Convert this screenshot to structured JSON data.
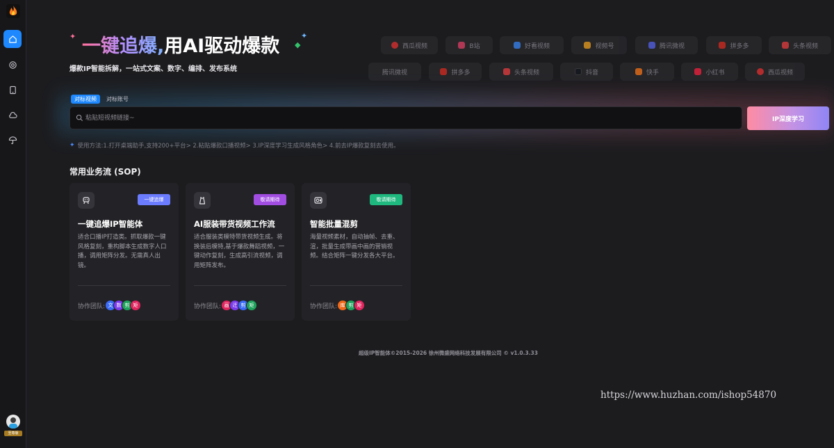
{
  "sidebar": {
    "nav": [
      {
        "name": "home"
      },
      {
        "name": "discover"
      },
      {
        "name": "tablet"
      },
      {
        "name": "cloud"
      },
      {
        "name": "umbrella"
      }
    ],
    "user": {
      "badge": "至尊版"
    }
  },
  "hero": {
    "title_gradient": "一键追爆,",
    "title_white": "用AI驱动爆款",
    "subtitle": "爆款IP智能拆解，一站式文案、数字、编排、发布系统"
  },
  "platforms_row1": [
    "西瓜视频",
    "B站",
    "好看视频",
    "视频号",
    "腾讯微视",
    "拼多多",
    "头条视频"
  ],
  "platforms_row2": [
    "腾讯微视",
    "拼多多",
    "头条视频",
    "抖音",
    "快手",
    "小红书",
    "西瓜视频"
  ],
  "search": {
    "tabs": [
      "对标视频",
      "对标账号"
    ],
    "placeholder": "粘贴短视频链接~",
    "button_label": "IP深度学习",
    "tip": "使用方法:1.打开桌端助手,支持200+平台> 2.粘贴爆款口播视频> 3.IP深度学习生成风格角色> 4.前去IP爆款复刻去使用。"
  },
  "sop": {
    "title": "常用业务流 (SOP)",
    "team_label": "协作团队:",
    "cards": [
      {
        "icon": "robot-icon",
        "badge": "一键追爆",
        "badge_color": "#6b7cff",
        "title": "一键追爆IP智能体",
        "desc": "适合口播IP打造类。抓取爆款一键风格复刻，重构脚本生成数字人口播，调用矩阵分发。无需真人出镜。",
        "members": [
          {
            "t": "文",
            "c": "#3b6cf6"
          },
          {
            "t": "数",
            "c": "#7c3aed"
          },
          {
            "t": "剪",
            "c": "#1fa35c"
          },
          {
            "t": "矩",
            "c": "#e0245e"
          }
        ]
      },
      {
        "icon": "dress-icon",
        "badge": "敬请期待",
        "badge_color": "#a24de2",
        "title": "AI服装带货视频工作流",
        "desc": "适合服装类模特带货视频生成。将换装后模特,基于爆款舞蹈视频，一键动作复刻，生成高引流视频，调用矩阵发布。",
        "members": [
          {
            "t": "画",
            "c": "#e0245e"
          },
          {
            "t": "迁",
            "c": "#7c3aed"
          },
          {
            "t": "剪",
            "c": "#3b6cf6"
          },
          {
            "t": "矩",
            "c": "#1fa35c"
          }
        ]
      },
      {
        "icon": "video-camera-icon",
        "badge": "敬请期待",
        "badge_color": "#1fb87f",
        "title": "智能批量混剪",
        "desc": "海量视频素材，自动抽帧、去重、渲，批量生成带画中画的营销视频。结合矩阵一键分发各大平台。",
        "members": [
          {
            "t": "库",
            "c": "#ef6a1a"
          },
          {
            "t": "剪",
            "c": "#1fa35c"
          },
          {
            "t": "矩",
            "c": "#e0245e"
          }
        ]
      }
    ]
  },
  "footer": "超级IP智能体©2015-2026 徐州微盛网络科技发展有限公司 © v1.0.3.33",
  "watermark": "https://www.huzhan.com/ishop54870"
}
